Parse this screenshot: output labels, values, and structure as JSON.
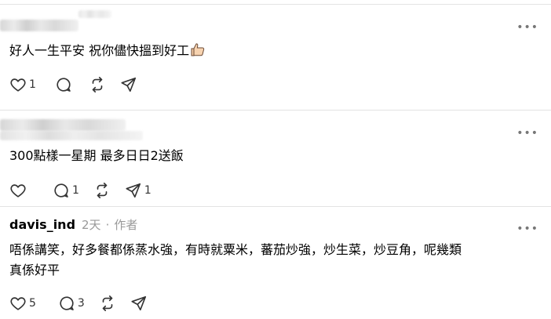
{
  "comments": [
    {
      "username": "",
      "text": "好人一生平安 祝你儘快搵到好工",
      "emoji": "thumbs-up",
      "likes": "1",
      "replies": "",
      "shares": ""
    },
    {
      "username": "",
      "text": "300點樣一星期 最多日日2送飯",
      "likes": "",
      "replies": "1",
      "shares": "1"
    },
    {
      "username": "davis_ind",
      "time": "2天",
      "separator": "·",
      "role": "作者",
      "text_lines": [
        "唔係講笑，好多餐都係蒸水強，有時就粟米，蕃茄炒強，炒生菜，炒豆角，呢幾類",
        "真係好平"
      ],
      "likes": "5",
      "replies": "3",
      "shares": ""
    }
  ],
  "more_label": "•••",
  "colors": {
    "text": "#000000",
    "muted": "#999999",
    "divider": "#e3e3e3",
    "icon": "#333333"
  },
  "icons": [
    "heart-icon",
    "comment-icon",
    "repost-icon",
    "share-icon",
    "more-icon",
    "thumbs-up-icon"
  ]
}
